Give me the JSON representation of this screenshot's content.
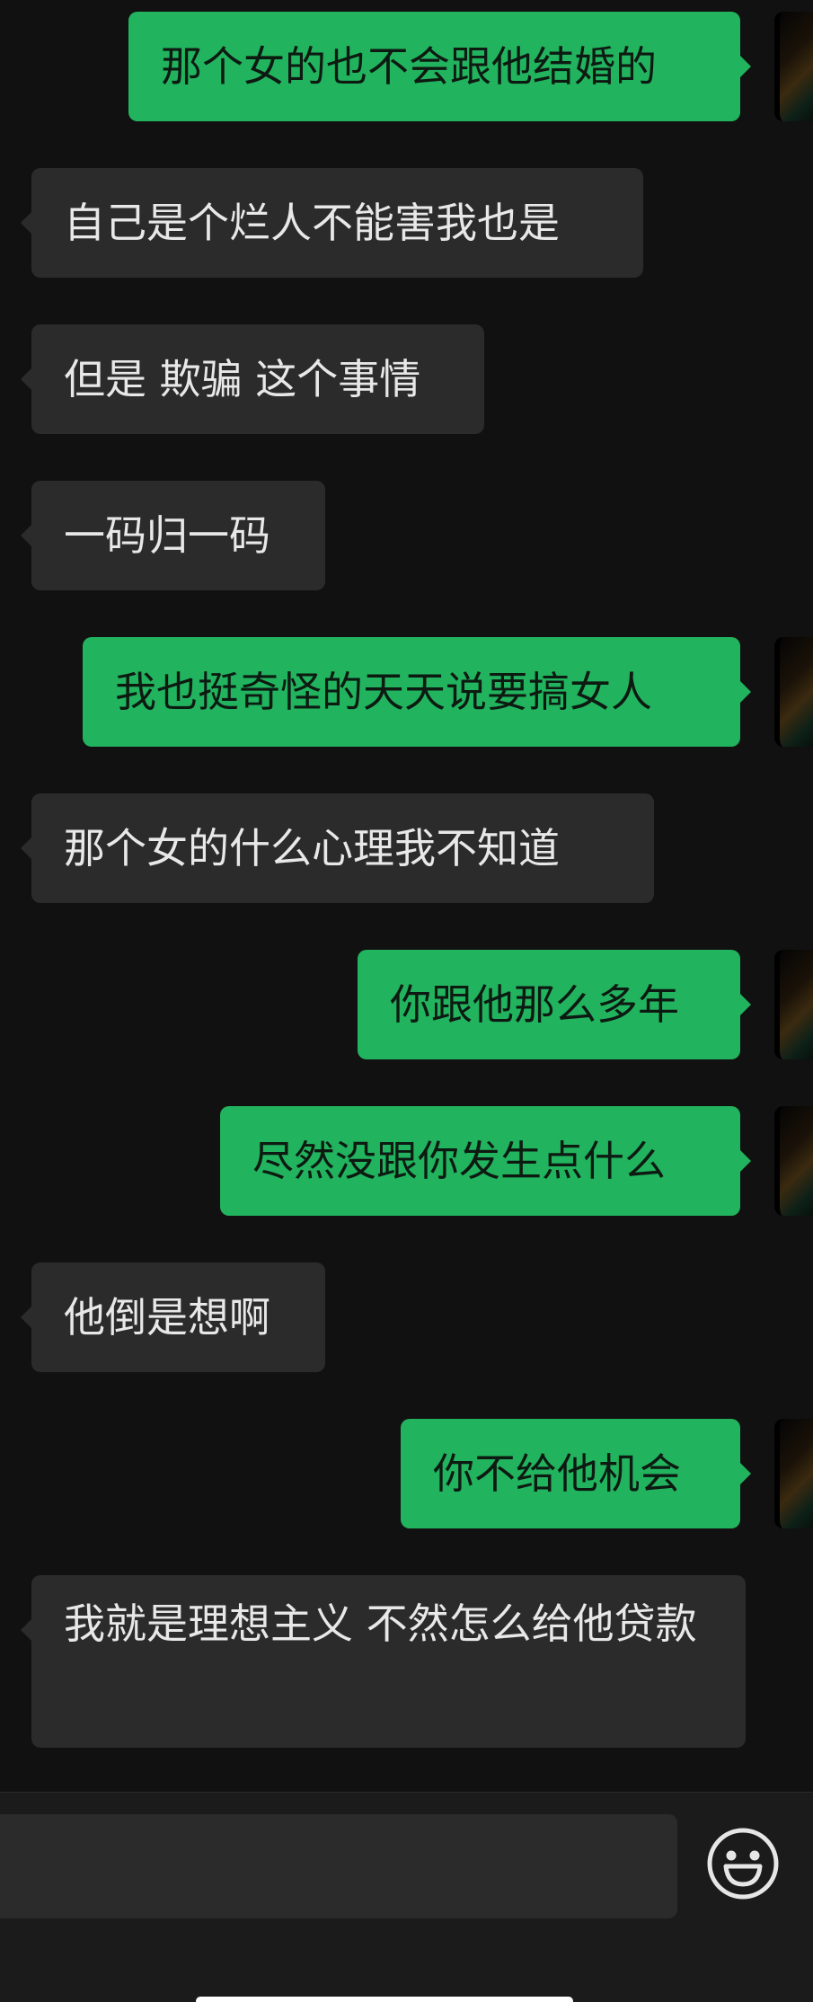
{
  "messages": [
    {
      "side": "out",
      "text": "那个女的也不会跟他结婚的"
    },
    {
      "side": "in",
      "text": "自己是个烂人不能害我也是"
    },
    {
      "side": "in",
      "text": "但是 欺骗 这个事情"
    },
    {
      "side": "in",
      "text": "一码归一码"
    },
    {
      "side": "out",
      "text": "我也挺奇怪的天天说要搞女人"
    },
    {
      "side": "in",
      "text": "那个女的什么心理我不知道"
    },
    {
      "side": "out",
      "text": "你跟他那么多年"
    },
    {
      "side": "out",
      "text": "尽然没跟你发生点什么"
    },
    {
      "side": "in",
      "text": "他倒是想啊"
    },
    {
      "side": "out",
      "text": "你不给他机会"
    },
    {
      "side": "in",
      "text": "我就是理想主义 不然怎么给他贷款"
    }
  ],
  "input": {
    "value": ""
  },
  "icons": {
    "emoji": "smiley-face-icon"
  },
  "colors": {
    "outgoing": "#22b35e",
    "incoming": "#2b2b2b",
    "background": "#111111"
  }
}
